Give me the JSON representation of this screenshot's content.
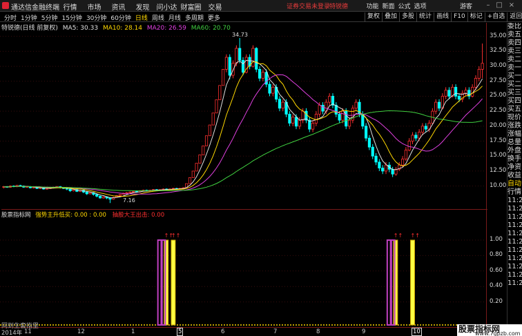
{
  "app": {
    "title": "通达信金融终端"
  },
  "top_menu": [
    "行情",
    "市场",
    "资讯",
    "发现",
    "问小达",
    "财富圈",
    "交易"
  ],
  "status": {
    "warning": "证券交易未登录",
    "stock": "特锐德"
  },
  "right_menu": [
    "功能",
    "新面",
    "公式",
    "选项"
  ],
  "guest": "游客",
  "window_controls": [
    "–",
    "□",
    "×"
  ],
  "periods": [
    "分时",
    "1分钟",
    "5分钟",
    "15分钟",
    "30分钟",
    "60分钟",
    "日线",
    "周线",
    "月线",
    "多周期",
    "更多"
  ],
  "active_period": "日线",
  "right_tools": [
    "复权",
    "叠加",
    "多股",
    "统计",
    "画线",
    "F10",
    "标记",
    "+自选",
    "返回"
  ],
  "legend": {
    "stock": "特锐德(日线 前复权)",
    "ma5": "MA5: 30.33",
    "ma10": "MA10: 28.14",
    "ma20": "MA20: 26.59",
    "ma60": "MA60: 20.70"
  },
  "price_axis": [
    "35.00",
    "32.50",
    "30.00",
    "27.50",
    "25.00",
    "22.50",
    "20.00",
    "17.50",
    "15.00",
    "12.50",
    "10.00"
  ],
  "annotations": {
    "high": "34.73",
    "low": "7.16"
  },
  "indicator": {
    "name": "股票指标网",
    "line1": "强势主升低买: 0.00 : 0.00",
    "line2": "抽股大王出击: 0.00"
  },
  "indi_axis": [
    "1.00",
    "0.80",
    "0.60",
    "0.40",
    "0.20"
  ],
  "side_panel": [
    "委比",
    "卖五",
    "卖四",
    "卖三",
    "卖二",
    "卖一",
    "买一",
    "买二",
    "买三",
    "买四",
    "买五",
    "现价",
    "涨跌",
    "涨幅",
    "总量",
    "外盘",
    "换手",
    "净资",
    "收益",
    "自动",
    "行情",
    "11:29",
    "11:29",
    "11:29",
    "11:29",
    "11:29",
    "11:29",
    "11:29",
    "11:29",
    "11:29",
    "11:29",
    "11:29"
  ],
  "dates": [
    "2014年",
    "11",
    "12",
    "1",
    "5",
    "6",
    "7",
    "8",
    "9",
    "10",
    "11"
  ],
  "bottom_watermark": "同到生套指里",
  "brand": {
    "line1": "股票指标网",
    "line2": "www.7gpzb.com"
  },
  "colors": {
    "up": "#ff3030",
    "down": "#00ffff",
    "ma5": "#e0e0e0",
    "ma10": "#ffd800",
    "ma20": "#e040e0",
    "ma60": "#40d040",
    "signal1": "#c040c0",
    "signal2": "#ffff40"
  },
  "chart_data": {
    "type": "candlestick",
    "y_range": [
      6.5,
      36
    ],
    "candles": [
      [
        9.8,
        9.9,
        9.6,
        10.0
      ],
      [
        9.9,
        9.8,
        9.7,
        10.0
      ],
      [
        9.8,
        10.0,
        9.7,
        10.1
      ],
      [
        10.0,
        9.9,
        9.8,
        10.1
      ],
      [
        9.9,
        10.1,
        9.8,
        10.2
      ],
      [
        10.1,
        10.0,
        9.9,
        10.2
      ],
      [
        10.0,
        9.8,
        9.7,
        10.1
      ],
      [
        9.8,
        9.9,
        9.7,
        10.0
      ],
      [
        9.9,
        9.7,
        9.6,
        10.0
      ],
      [
        9.7,
        9.8,
        9.6,
        9.9
      ],
      [
        9.8,
        9.6,
        9.5,
        9.9
      ],
      [
        9.6,
        9.7,
        9.5,
        9.8
      ],
      [
        9.7,
        9.5,
        9.4,
        9.8
      ],
      [
        9.5,
        9.6,
        9.4,
        9.7
      ],
      [
        9.6,
        9.7,
        9.5,
        9.8
      ],
      [
        9.7,
        9.8,
        9.6,
        9.9
      ],
      [
        9.8,
        9.9,
        9.7,
        10.0
      ],
      [
        9.9,
        9.7,
        9.6,
        10.0
      ],
      [
        9.7,
        9.6,
        9.5,
        9.8
      ],
      [
        9.6,
        9.5,
        9.3,
        9.7
      ],
      [
        9.5,
        9.2,
        9.0,
        9.6
      ],
      [
        9.2,
        9.4,
        9.1,
        9.5
      ],
      [
        9.4,
        9.1,
        9.0,
        9.5
      ],
      [
        9.1,
        9.3,
        9.0,
        9.4
      ],
      [
        9.3,
        9.0,
        8.8,
        9.4
      ],
      [
        9.0,
        8.7,
        8.5,
        9.1
      ],
      [
        8.7,
        8.9,
        8.6,
        9.0
      ],
      [
        8.9,
        8.6,
        8.4,
        9.0
      ],
      [
        8.6,
        8.3,
        8.1,
        8.7
      ],
      [
        8.3,
        8.0,
        7.9,
        8.4
      ],
      [
        8.0,
        8.2,
        7.9,
        8.3
      ],
      [
        8.2,
        8.0,
        7.8,
        8.3
      ],
      [
        8.0,
        7.8,
        7.16,
        8.1
      ],
      [
        7.8,
        8.1,
        7.7,
        8.2
      ],
      [
        8.1,
        8.4,
        8.0,
        8.5
      ],
      [
        8.4,
        8.6,
        8.3,
        8.7
      ],
      [
        8.6,
        8.8,
        8.5,
        8.9
      ],
      [
        8.8,
        8.9,
        8.7,
        9.0
      ],
      [
        8.9,
        9.0,
        8.8,
        9.1
      ],
      [
        9.0,
        9.1,
        8.9,
        9.2
      ],
      [
        9.1,
        9.0,
        8.9,
        9.2
      ],
      [
        9.0,
        9.2,
        8.9,
        9.3
      ],
      [
        9.2,
        9.3,
        9.1,
        9.4
      ],
      [
        9.3,
        9.2,
        9.1,
        9.4
      ],
      [
        9.2,
        9.3,
        9.1,
        9.4
      ],
      [
        9.3,
        9.4,
        9.2,
        9.5
      ],
      [
        9.4,
        9.3,
        9.2,
        9.5
      ],
      [
        9.3,
        9.4,
        9.2,
        9.5
      ],
      [
        9.4,
        9.5,
        9.3,
        9.6
      ],
      [
        9.5,
        9.4,
        9.3,
        9.6
      ],
      [
        9.4,
        9.5,
        9.3,
        9.6
      ],
      [
        9.5,
        9.6,
        9.4,
        9.7
      ],
      [
        9.6,
        9.5,
        9.4,
        9.7
      ],
      [
        9.5,
        9.6,
        9.4,
        9.7
      ],
      [
        9.6,
        9.7,
        9.5,
        9.8
      ],
      [
        9.7,
        10.4,
        9.7,
        10.4
      ],
      [
        10.4,
        11.4,
        10.4,
        11.4
      ],
      [
        11.4,
        12.5,
        11.4,
        12.5
      ],
      [
        12.5,
        13.8,
        12.5,
        13.8
      ],
      [
        13.8,
        15.2,
        13.8,
        15.2
      ],
      [
        15.2,
        16.7,
        15.2,
        16.7
      ],
      [
        16.7,
        18.4,
        16.7,
        18.4
      ],
      [
        18.4,
        20.2,
        18.4,
        20.2
      ],
      [
        20.2,
        22.2,
        20.2,
        22.2
      ],
      [
        22.2,
        24.4,
        22.2,
        24.4
      ],
      [
        24.4,
        26.8,
        24.4,
        26.8
      ],
      [
        26.8,
        29.5,
        26.8,
        29.5
      ],
      [
        29.5,
        31.5,
        29.0,
        32.0
      ],
      [
        31.5,
        28.5,
        27.8,
        32.0
      ],
      [
        28.5,
        30.5,
        28.0,
        31.0
      ],
      [
        30.5,
        33.0,
        30.0,
        33.5
      ],
      [
        33.0,
        31.0,
        30.5,
        34.73
      ],
      [
        31.0,
        29.0,
        28.5,
        31.5
      ],
      [
        29.0,
        31.5,
        28.8,
        32.0
      ],
      [
        31.5,
        30.0,
        29.5,
        32.0
      ],
      [
        30.0,
        33.0,
        29.8,
        33.5
      ],
      [
        33.0,
        29.5,
        29.0,
        33.2
      ],
      [
        29.5,
        28.0,
        27.5,
        30.0
      ],
      [
        28.0,
        29.0,
        27.5,
        29.5
      ],
      [
        29.0,
        27.0,
        26.5,
        29.5
      ],
      [
        27.0,
        25.5,
        25.0,
        27.5
      ],
      [
        25.5,
        26.5,
        25.0,
        27.0
      ],
      [
        26.5,
        24.5,
        24.0,
        27.0
      ],
      [
        24.5,
        23.0,
        22.5,
        25.0
      ],
      [
        23.0,
        24.0,
        22.5,
        24.5
      ],
      [
        24.0,
        22.0,
        21.5,
        24.5
      ],
      [
        22.0,
        20.5,
        20.0,
        22.5
      ],
      [
        20.5,
        21.5,
        20.0,
        22.0
      ],
      [
        21.5,
        20.0,
        19.5,
        22.0
      ],
      [
        20.0,
        21.0,
        19.5,
        21.5
      ],
      [
        21.0,
        22.5,
        20.5,
        23.0
      ],
      [
        22.5,
        21.0,
        20.5,
        23.0
      ],
      [
        21.0,
        19.5,
        19.0,
        21.5
      ],
      [
        19.5,
        20.5,
        19.0,
        21.0
      ],
      [
        20.5,
        22.0,
        20.0,
        22.5
      ],
      [
        22.0,
        23.5,
        21.5,
        24.0
      ],
      [
        23.5,
        22.5,
        22.0,
        24.0
      ],
      [
        22.5,
        24.0,
        22.0,
        24.5
      ],
      [
        24.0,
        25.0,
        23.5,
        25.5
      ],
      [
        25.0,
        23.5,
        23.0,
        25.5
      ],
      [
        23.5,
        22.0,
        21.5,
        24.0
      ],
      [
        22.0,
        21.0,
        20.5,
        22.5
      ],
      [
        21.0,
        22.5,
        20.5,
        23.0
      ],
      [
        22.5,
        20.0,
        19.5,
        23.0
      ],
      [
        20.0,
        21.0,
        19.5,
        21.5
      ],
      [
        21.0,
        23.0,
        20.5,
        23.5
      ],
      [
        23.0,
        24.0,
        22.5,
        24.5
      ],
      [
        24.0,
        22.0,
        21.5,
        24.5
      ],
      [
        22.0,
        20.0,
        19.5,
        22.5
      ],
      [
        20.0,
        18.0,
        17.5,
        20.5
      ],
      [
        18.0,
        16.5,
        16.0,
        18.5
      ],
      [
        16.5,
        15.0,
        14.5,
        17.0
      ],
      [
        15.0,
        14.0,
        13.5,
        15.5
      ],
      [
        14.0,
        13.0,
        12.5,
        14.5
      ],
      [
        13.0,
        12.5,
        12.0,
        13.5
      ],
      [
        12.5,
        13.5,
        12.0,
        14.0
      ],
      [
        13.5,
        12.8,
        12.3,
        14.0
      ],
      [
        12.8,
        12.0,
        11.5,
        13.2
      ],
      [
        12.0,
        12.8,
        11.7,
        13.2
      ],
      [
        12.8,
        13.5,
        12.5,
        14.0
      ],
      [
        13.5,
        14.5,
        13.2,
        15.0
      ],
      [
        14.5,
        16.0,
        14.2,
        16.5
      ],
      [
        16.0,
        17.5,
        15.8,
        18.0
      ],
      [
        17.5,
        18.5,
        17.0,
        19.0
      ],
      [
        18.5,
        18.0,
        17.5,
        19.0
      ],
      [
        18.0,
        19.0,
        17.5,
        19.5
      ],
      [
        19.0,
        20.0,
        18.5,
        20.5
      ],
      [
        20.0,
        19.5,
        19.0,
        20.5
      ],
      [
        19.5,
        20.5,
        19.0,
        21.0
      ],
      [
        20.5,
        22.5,
        20.2,
        23.0
      ],
      [
        22.5,
        24.0,
        22.0,
        24.5
      ],
      [
        24.0,
        23.0,
        22.5,
        24.5
      ],
      [
        23.0,
        25.0,
        22.8,
        25.5
      ],
      [
        25.0,
        26.0,
        24.5,
        26.5
      ],
      [
        26.0,
        25.0,
        24.5,
        26.5
      ],
      [
        25.0,
        26.5,
        24.8,
        27.0
      ],
      [
        26.5,
        25.0,
        24.5,
        27.0
      ],
      [
        25.0,
        24.5,
        24.0,
        25.5
      ],
      [
        24.5,
        25.5,
        24.0,
        26.0
      ],
      [
        25.5,
        26.0,
        25.0,
        26.5
      ],
      [
        26.0,
        25.0,
        24.5,
        26.5
      ],
      [
        25.0,
        26.5,
        24.8,
        27.0
      ],
      [
        26.5,
        28.0,
        26.0,
        28.5
      ],
      [
        28.0,
        29.5,
        27.5,
        30.0
      ],
      [
        29.5,
        30.5,
        28.0,
        33.8
      ]
    ],
    "signals": [
      {
        "index": 47,
        "s1": 1.0,
        "s2": 1.0
      },
      {
        "index": 48,
        "s1": 1.0,
        "s2": 0.0
      },
      {
        "index": 51,
        "s1": 0.0,
        "s2": 1.0
      },
      {
        "index": 116,
        "s1": 1.0,
        "s2": 1.0
      },
      {
        "index": 117,
        "s1": 1.0,
        "s2": 0.0
      },
      {
        "index": 123,
        "s1": 0.0,
        "s2": 1.0
      }
    ]
  }
}
